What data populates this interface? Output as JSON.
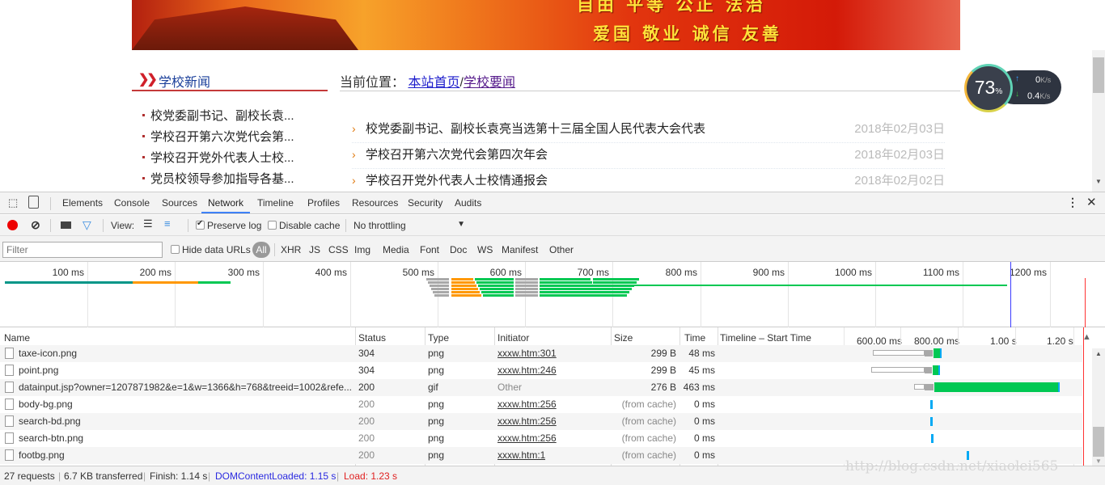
{
  "page": {
    "banner_slogans": [
      "自由 平等 公正 法治",
      "爱国 敬业 诚信 友善"
    ],
    "sidebar": {
      "title": "学校新闻",
      "items": [
        "校党委副书记、副校长袁...",
        "学校召开第六次党代会第...",
        "学校召开党外代表人士校...",
        "党员校领导参加指导各基..."
      ]
    },
    "breadcrumb": {
      "label": "当前位置：",
      "home": "本站首页",
      "separator": "/",
      "current": "学校要闻"
    },
    "news": [
      {
        "title": "校党委副书记、副校长袁亮当选第十三届全国人民代表大会代表",
        "date": "2018年02月03日"
      },
      {
        "title": "学校召开第六次党代会第四次年会",
        "date": "2018年02月03日"
      },
      {
        "title": "学校召开党外代表人士校情通报会",
        "date": "2018年02月02日"
      }
    ],
    "net_gauge": {
      "percent": "73",
      "percent_sign": "%",
      "upload": "0",
      "download": "0.4",
      "unit": "K/s"
    }
  },
  "devtools": {
    "tabs": [
      "Elements",
      "Console",
      "Sources",
      "Network",
      "Timeline",
      "Profiles",
      "Resources",
      "Security",
      "Audits"
    ],
    "active_tab": "Network",
    "toolbar": {
      "view_label": "View:",
      "preserve_log": "Preserve log",
      "preserve_log_checked": true,
      "disable_cache": "Disable cache",
      "disable_cache_checked": false,
      "throttling": "No throttling"
    },
    "filter": {
      "placeholder": "Filter",
      "hide_data_urls": "Hide data URLs",
      "types": [
        "All",
        "XHR",
        "JS",
        "CSS",
        "Img",
        "Media",
        "Font",
        "Doc",
        "WS",
        "Manifest",
        "Other"
      ],
      "active_type": "All"
    },
    "overview_ticks": [
      "100 ms",
      "200 ms",
      "300 ms",
      "400 ms",
      "500 ms",
      "600 ms",
      "700 ms",
      "800 ms",
      "900 ms",
      "1000 ms",
      "1100 ms",
      "1200 ms"
    ],
    "columns": [
      "Name",
      "Status",
      "Type",
      "Initiator",
      "Size",
      "Time",
      "Timeline – Start Time"
    ],
    "timeline_ticks": [
      "600.00 ms",
      "800.00 ms",
      "1.00 s",
      "1.20 s"
    ],
    "rows": [
      {
        "name": "taxe-icon.png",
        "status": "304",
        "type": "png",
        "initiator": "xxxw.htm:301",
        "size": "299 B",
        "time": "48 ms"
      },
      {
        "name": "point.png",
        "status": "304",
        "type": "png",
        "initiator": "xxxw.htm:246",
        "size": "299 B",
        "time": "45 ms"
      },
      {
        "name": "datainput.jsp?owner=1207871982&e=1&w=1366&h=768&treeid=1002&refe...",
        "status": "200",
        "type": "gif",
        "initiator": "Other",
        "size": "276 B",
        "time": "463 ms"
      },
      {
        "name": "body-bg.png",
        "status": "200",
        "type": "png",
        "initiator": "xxxw.htm:256",
        "size": "(from cache)",
        "time": "0 ms"
      },
      {
        "name": "search-bd.png",
        "status": "200",
        "type": "png",
        "initiator": "xxxw.htm:256",
        "size": "(from cache)",
        "time": "0 ms"
      },
      {
        "name": "search-btn.png",
        "status": "200",
        "type": "png",
        "initiator": "xxxw.htm:256",
        "size": "(from cache)",
        "time": "0 ms"
      },
      {
        "name": "footbg.png",
        "status": "200",
        "type": "png",
        "initiator": "xxxw.htm:1",
        "size": "(from cache)",
        "time": "0 ms"
      }
    ],
    "status_bar": {
      "requests": "27 requests",
      "transferred": "6.7 KB transferred",
      "finish": "Finish: 1.14 s",
      "dom_content_loaded": "DOMContentLoaded: 1.15 s",
      "load": "Load: 1.23 s"
    },
    "colors": {
      "waiting": "#00c853",
      "download": "#03a9f4",
      "stalled": "#a8a8a8",
      "dns": "#009688",
      "ssl": "#ff9800",
      "dcl_line": "#3b3bff",
      "load_line": "#ff3333"
    }
  },
  "watermark": "http://blog.csdn.net/xiaolei565"
}
